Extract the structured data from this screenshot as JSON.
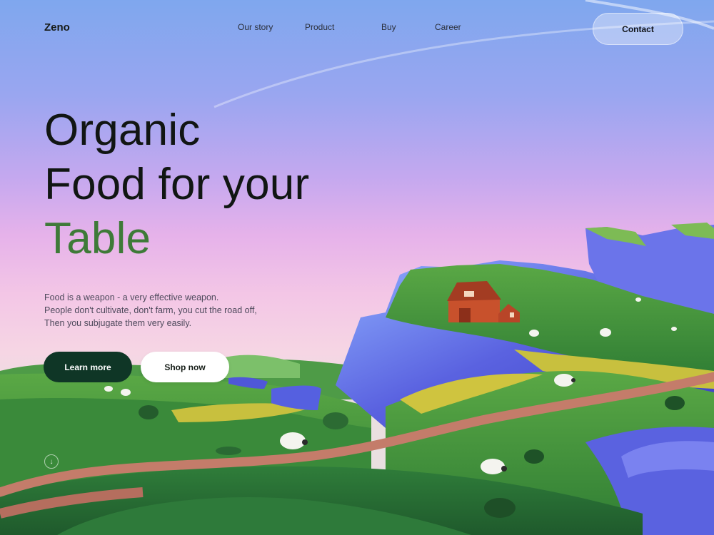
{
  "nav": {
    "brand": "Zeno",
    "links": [
      "Our story",
      "Product",
      "Buy",
      "Career"
    ],
    "contact_label": "Contact"
  },
  "hero": {
    "title_line1": "Organic",
    "title_line2": "Food for your",
    "title_line3": "Table",
    "description": [
      "Food is a weapon - a very effective weapon.",
      "People don't cultivate, don't farm, you cut the road off,",
      "Then you subjugate them very easily."
    ],
    "learn_more_label": "Learn more",
    "shop_now_label": "Shop now",
    "scroll_icon": "arrow-down-icon",
    "scroll_glyph": "↓"
  },
  "colors": {
    "title_accent": "#3e7a38",
    "primary_button": "#0f3626",
    "sky_top": "#7fa7ee",
    "sky_bottom": "#f3c6e6",
    "grass": "#3f8f3a",
    "cliff": "#5a62e0",
    "barn": "#c8512c"
  }
}
